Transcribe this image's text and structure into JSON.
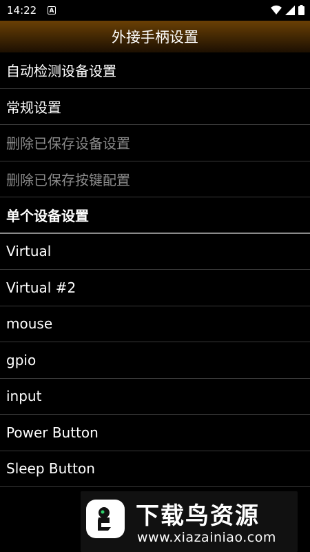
{
  "status_bar": {
    "time": "14:22",
    "notification_icon": "A",
    "icons": [
      "wifi-icon",
      "signal-icon",
      "battery-icon"
    ]
  },
  "title_bar": {
    "title": "外接手柄设置"
  },
  "menu": {
    "items": [
      {
        "label": "自动检测设备设置",
        "enabled": true
      },
      {
        "label": "常规设置",
        "enabled": true
      },
      {
        "label": "删除已保存设备设置",
        "enabled": false
      },
      {
        "label": "删除已保存按键配置",
        "enabled": false
      }
    ]
  },
  "devices": {
    "header": "单个设备设置",
    "items": [
      "Virtual",
      "Virtual #2",
      "mouse",
      "gpio",
      "input",
      "Power Button",
      "Sleep Button"
    ]
  },
  "watermark": {
    "title": "下载鸟资源",
    "url": "www.xiazainiao.com"
  },
  "colors": {
    "title_bar_top": "#6a4004",
    "title_bar_bottom": "#1d1001",
    "disabled_text": "#8a8a8a",
    "divider": "#3a3a3a"
  }
}
